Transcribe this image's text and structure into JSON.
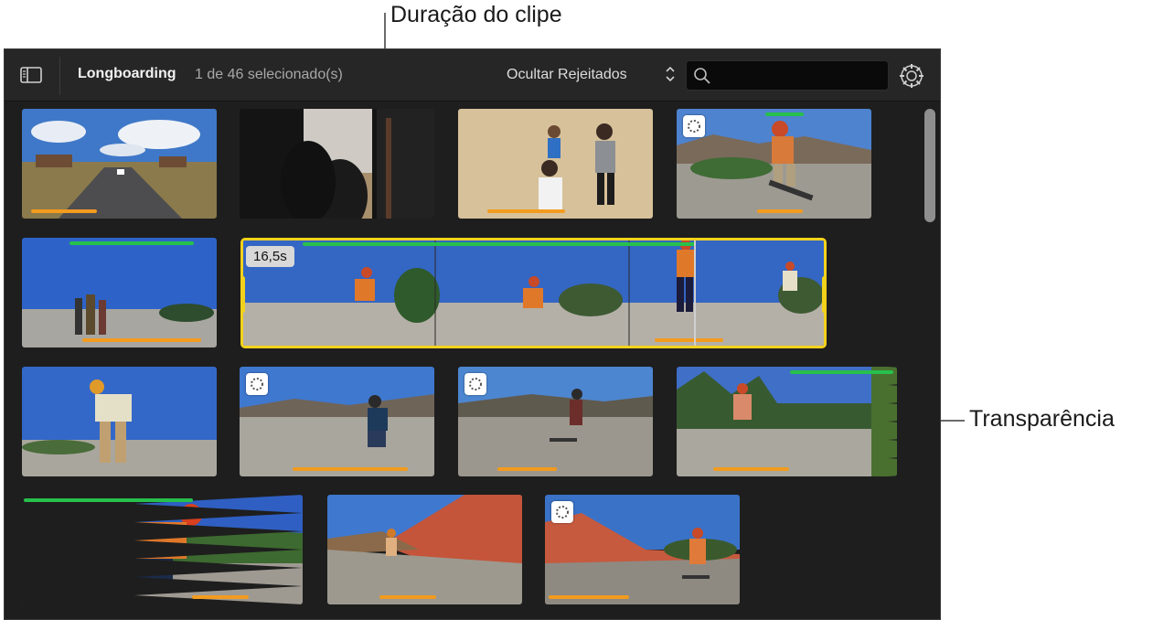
{
  "callouts": {
    "duration": "Duração do clipe",
    "transparency": "Transparência"
  },
  "toolbar": {
    "sidebar_icon": "sidebar-toggle-icon",
    "library_title": "Longboarding",
    "selection_count": "1 de 46 selecionado(s)",
    "filter_label": "Ocultar Rejeitados",
    "filter_icon": "chevron-updown-icon",
    "search_icon": "search-icon",
    "search_value": "",
    "settings_icon": "gear-icon"
  },
  "selected_clip": {
    "duration_label": "16,5s"
  },
  "colors": {
    "accent_selection": "#f3d21c",
    "favorite_line": "#27c04c",
    "analysis_line": "#f39b1f",
    "window_bg": "#1e1e1e",
    "toolbar_bg": "#262626"
  },
  "clips_rows": [
    [
      "desert-highway",
      "car-interior",
      "desert-people-walking",
      "skater-jumping"
    ],
    [
      "group-on-road",
      "selected-multi-frame-clip"
    ],
    [
      "skater-lean-wide",
      "skater-crouch",
      "skater-riding",
      "skater-with-trees"
    ],
    [
      "skater-crouch-closeup",
      "red-rock-road",
      "red-rock-skater"
    ]
  ]
}
